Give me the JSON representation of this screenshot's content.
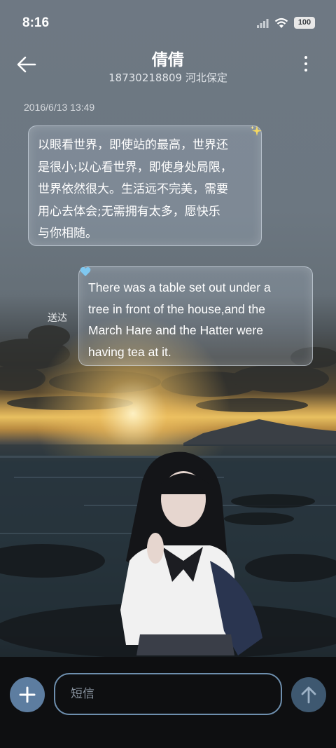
{
  "status_bar": {
    "time": "8:16",
    "battery": "100",
    "icons": [
      "signal-icon",
      "wifi-icon",
      "battery-icon"
    ]
  },
  "header": {
    "contact_name": "倩倩",
    "phone_location": "18730218809 河北保定",
    "back_icon": "arrow-left-icon",
    "more_icon": "more-vertical-icon"
  },
  "conversation": {
    "timestamp": "2016/6/13 13:49",
    "messages": [
      {
        "direction": "incoming",
        "lines": [
          "以眼看世界，即使站的最高，世界还",
          "是很小;以心看世界，即使身处局限，",
          "世界依然很大。生活远不完美，需要",
          "用心去体会;无需拥有太多，愿快乐",
          "与你相随。"
        ],
        "decoration": "sparkle-icon"
      },
      {
        "direction": "outgoing",
        "lines": [
          "There was a table set out under a",
          "tree in front of the house,and the",
          "March Hare and the Hatter were",
          "having tea at it."
        ],
        "decoration": "heart-icon",
        "status": "送达"
      }
    ]
  },
  "composer": {
    "placeholder": "短信",
    "value": "",
    "add_icon": "plus-icon",
    "send_icon": "arrow-up-icon"
  },
  "colors": {
    "accent": "#5d7da0",
    "send_button": "#3e5870",
    "input_border": "#6e8fae"
  }
}
